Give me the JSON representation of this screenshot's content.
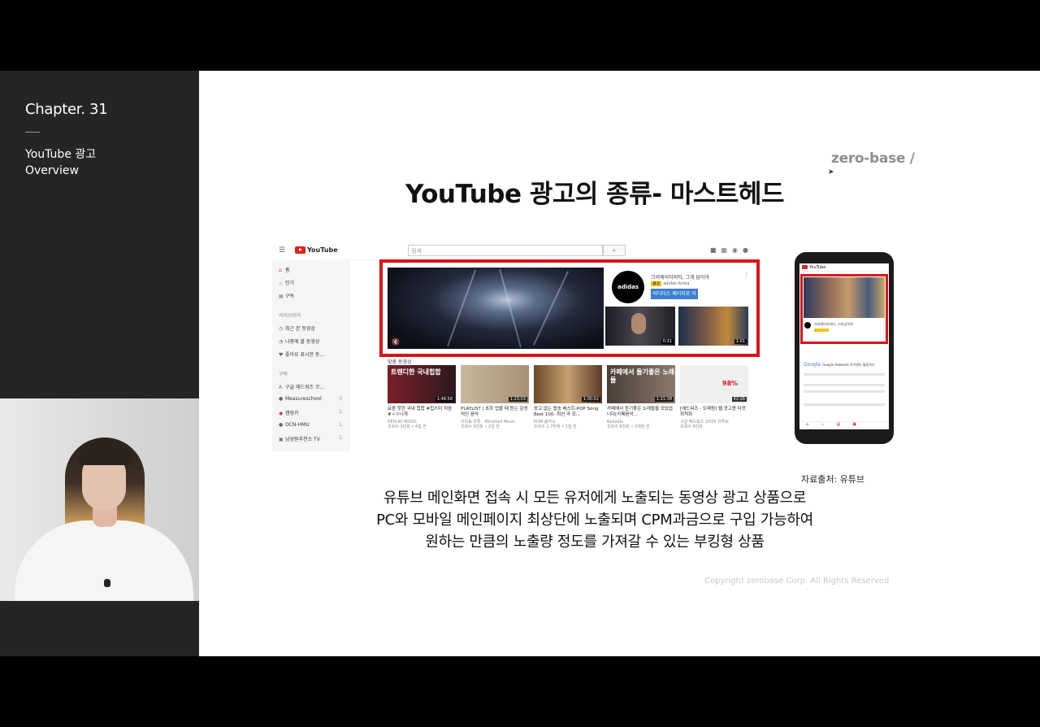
{
  "sidebar": {
    "chapter": "Chapter. 31",
    "topic_line1": "YouTube 광고",
    "topic_line2": "Overview"
  },
  "slide": {
    "brand": "zero-base /",
    "title": "YouTube 광고의 종류- 마스트헤드",
    "source": "자료출처: 유튜브",
    "description": [
      "유튜브 메인화면 접속 시 모든 유저에게 노출되는 동영상 광고 상품으로",
      "PC와 모바일 메인페이지 최상단에 노출되며 CPM과금으로 구입 가능하여",
      "원하는 만큼의 노출량 정도를 가져갈 수 있는 부킹형 상품"
    ],
    "copyright": "Copyright zerobase Corp. All Rights Reserved"
  },
  "youtube": {
    "logo": "YouTube",
    "search_placeholder": "검색",
    "sidebar_items": [
      "홈",
      "인기",
      "구독"
    ],
    "library_heading": "라이브러리",
    "library_items": [
      "최근 본 동영상",
      "나중에 볼 동영상",
      "좋아요 표시한 동..."
    ],
    "subs_heading": "구독",
    "subs_items": [
      {
        "label": "구글 애드워즈 코...",
        "count": ""
      },
      {
        "label": "Measureschool",
        "count": "3"
      },
      {
        "label": "캠핑카",
        "count": "2"
      },
      {
        "label": "OCN-HMU",
        "count": "1"
      },
      {
        "label": "남성원추천소 TV",
        "count": "1"
      }
    ],
    "masthead": {
      "advertiser": "adidas",
      "ad_title": "크리에이티비티, 그게 답이야",
      "ad_badge": "광고",
      "ad_channel": "adidas Korea",
      "cta": "아디다스 페이지로 이동",
      "thumb1_duration": "0:31",
      "thumb2_duration": "1:01"
    },
    "section_title": "맞춤 동영상",
    "videos": [
      {
        "overlay": "트렌디한 국내힙합",
        "duration": "1:48:58",
        "title": "요즘 핫한 국내 힙합 #힙스터 저음 #ㅅㅇ니게",
        "meta": "REPLAY MUSIC",
        "meta2": "조회수 3만회 • 4일 전",
        "color": "#7a1f2a"
      },
      {
        "overlay": "",
        "duration": "1:23:03",
        "title": "PLAYLIST | 초하 업을 때 듣는 감성적인 음악",
        "meta": "이야동 유튜 · Minishell Music",
        "meta2": "조회수 9천회 • 2일 전",
        "color": "#b8a48a"
      },
      {
        "overlay": "",
        "duration": "1:00:02",
        "title": "광고 없는 팝송 베스트-POP Song Best 100- 최신 곡 모...",
        "meta": "EDM 음악소",
        "meta2": "조회수 2.7만회 • 1일 전",
        "color": "#8a6a4a"
      },
      {
        "overlay": "카페에서 들기좋은 노래들",
        "duration": "1:21:38",
        "title": "카페에서 듣기좋은 노래들을 모았습니다[카페음악...",
        "meta": "Balladio",
        "meta2": "조회수 8천회 • 3개월 전",
        "color": "#6a5a4e"
      },
      {
        "overlay": "98%",
        "duration": "42:28",
        "title": "[애드워즈 - 도매원] 웹 광고용 타겟 최적화",
        "meta": "구글 애드워즈 코리아 유투브",
        "meta2": "조회수 4만회",
        "color": "#e8e8e8"
      }
    ]
  },
  "phone": {
    "logo": "YouTube",
    "google": "Google",
    "google_sub": "Google Adwords 아이덴티 활용하기"
  },
  "colors": {
    "masthead_border": "#d8141c",
    "youtube_red": "#e62117",
    "sidebar_bg": "#252525",
    "cta_blue": "#3b7fd4"
  }
}
